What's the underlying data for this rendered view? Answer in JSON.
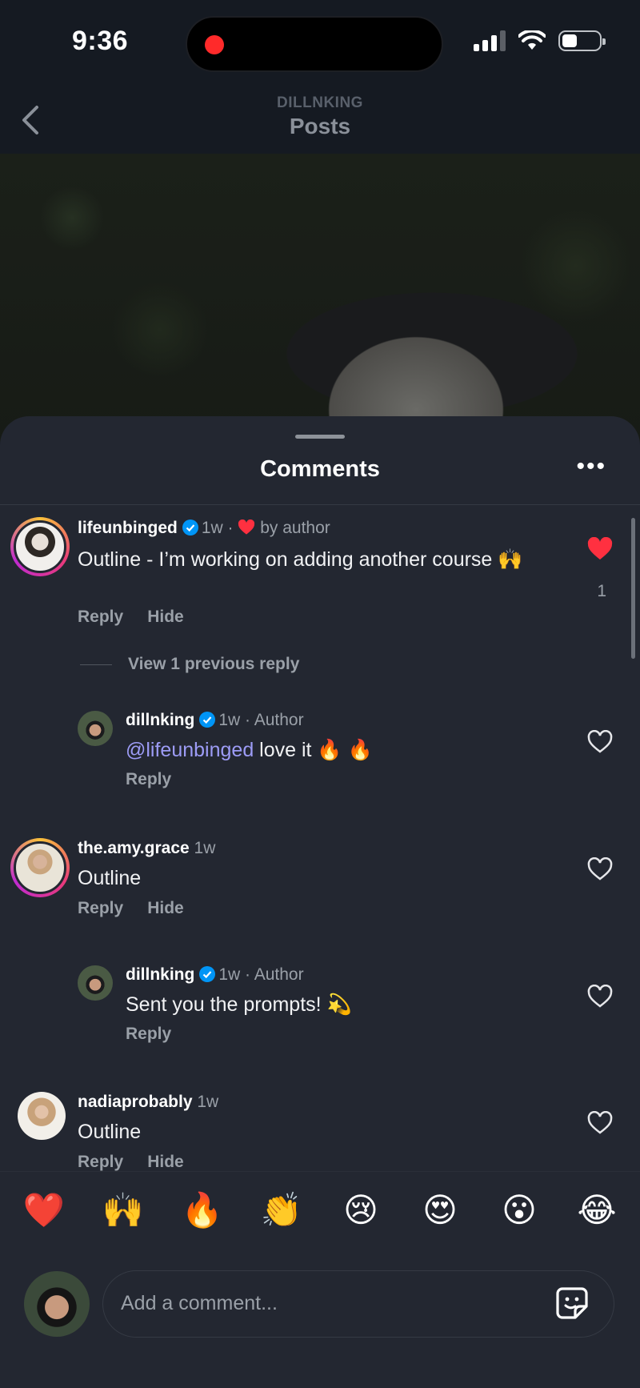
{
  "status": {
    "time": "9:36"
  },
  "nav": {
    "subtitle": "DILLNKING",
    "title": "Posts"
  },
  "sheet": {
    "title": "Comments"
  },
  "comments": [
    {
      "username": "lifeunbinged",
      "verified": true,
      "time": "1w",
      "sep": "·",
      "author_like": "by author",
      "text": "Outline - I’m working on adding another course 🙌",
      "reply": "Reply",
      "hide": "Hide",
      "likes": "1",
      "liked": true
    },
    {
      "username": "dillnking",
      "verified": true,
      "time": "1w",
      "role": "Author",
      "sep": "·",
      "mention": "@lifeunbinged",
      "text": "love it 🔥 🔥",
      "reply": "Reply"
    },
    {
      "username": "the.amy.grace",
      "time": "1w",
      "text": "Outline",
      "reply": "Reply",
      "hide": "Hide"
    },
    {
      "username": "dillnking",
      "verified": true,
      "time": "1w",
      "role": "Author",
      "sep": "·",
      "text": "Sent you the prompts! 💫",
      "reply": "Reply"
    },
    {
      "username": "nadiaprobably",
      "time": "1w",
      "text": "Outline",
      "reply": "Reply",
      "hide": "Hide"
    }
  ],
  "view_replies": "View 1 previous reply",
  "emoji_bar": [
    "❤️",
    "🙌",
    "🔥",
    "👏",
    "😢",
    "😍",
    "😮",
    "😂"
  ],
  "composer": {
    "placeholder": "Add a comment..."
  },
  "colors": {
    "sheet_bg": "#232731",
    "mention": "#9d9cf6",
    "like_red": "#ff3040",
    "verified_blue": "#0095f6"
  }
}
